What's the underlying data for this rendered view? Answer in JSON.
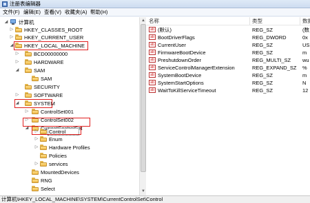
{
  "window": {
    "title": "注册表编辑器"
  },
  "menu": {
    "items": [
      "文件(F)",
      "编辑(E)",
      "查看(V)",
      "收藏夹(A)",
      "帮助(H)"
    ]
  },
  "tree": {
    "nodes": [
      {
        "label": "计算机",
        "expander": "◢"
      },
      {
        "label": "HKEY_CLASSES_ROOT",
        "expander": "▷"
      },
      {
        "label": "HKEY_CURRENT_USER",
        "expander": "▷"
      },
      {
        "label": "HKEY_LOCAL_MACHINE",
        "expander": "◢"
      },
      {
        "label": "BCD00000000",
        "expander": "▷"
      },
      {
        "label": "HARDWARE",
        "expander": "▷"
      },
      {
        "label": "SAM",
        "expander": "◢"
      },
      {
        "label": "SAM",
        "expander": ""
      },
      {
        "label": "SECURITY",
        "expander": ""
      },
      {
        "label": "SOFTWARE",
        "expander": "▷"
      },
      {
        "label": "SYSTEM",
        "expander": "◢"
      },
      {
        "label": "ControlSet001",
        "expander": "▷"
      },
      {
        "label": "ControlSet002",
        "expander": "▷"
      },
      {
        "label": "CurrentControlSet",
        "expander": "◢"
      },
      {
        "label": "Control",
        "expander": "▷"
      },
      {
        "label": "Enum",
        "expander": "▷"
      },
      {
        "label": "Hardware Profiles",
        "expander": "▷"
      },
      {
        "label": "Policies",
        "expander": ""
      },
      {
        "label": "services",
        "expander": "▷"
      },
      {
        "label": "MountedDevices",
        "expander": ""
      },
      {
        "label": "RNG",
        "expander": ""
      },
      {
        "label": "Select",
        "expander": ""
      }
    ]
  },
  "list": {
    "columns": [
      "名称",
      "类型",
      "数据"
    ],
    "rows": [
      {
        "name": "(默认)",
        "type": "REG_SZ",
        "data": "(数"
      },
      {
        "name": "BootDriverFlags",
        "type": "REG_DWORD",
        "data": "0x"
      },
      {
        "name": "CurrentUser",
        "type": "REG_SZ",
        "data": "US"
      },
      {
        "name": "FirmwareBootDevice",
        "type": "REG_SZ",
        "data": "m"
      },
      {
        "name": "PreshutdownOrder",
        "type": "REG_MULTI_SZ",
        "data": "wu"
      },
      {
        "name": "ServiceControlManagerExtension",
        "type": "REG_EXPAND_SZ",
        "data": "%"
      },
      {
        "name": "SystemBootDevice",
        "type": "REG_SZ",
        "data": "m"
      },
      {
        "name": "SystemStartOptions",
        "type": "REG_SZ",
        "data": "N"
      },
      {
        "name": "WaitToKillServiceTimeout",
        "type": "REG_SZ",
        "data": "12"
      }
    ],
    "value_icon": "ab"
  },
  "status": {
    "path": "计算机\\HKEY_LOCAL_MACHINE\\SYSTEM\\CurrentControlSet\\Control"
  },
  "colors": {
    "highlight": "#e01d1d",
    "folder": "#f4c95d"
  }
}
